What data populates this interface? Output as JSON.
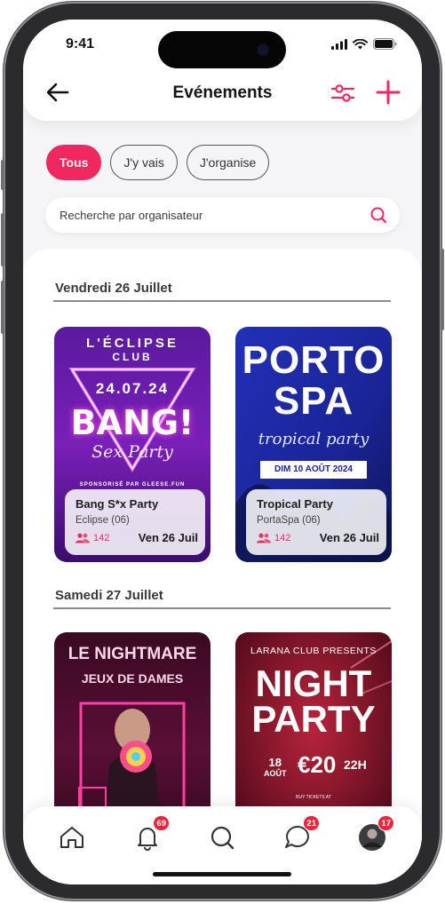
{
  "status": {
    "time": "9:41"
  },
  "header": {
    "title": "Evénements"
  },
  "filters": [
    {
      "label": "Tous",
      "active": true
    },
    {
      "label": "J'y vais",
      "active": false
    },
    {
      "label": "J'organise",
      "active": false
    }
  ],
  "search": {
    "placeholder": "Recherche par organisateur"
  },
  "sections": [
    {
      "title": "Vendredi 26 Juillet",
      "events": [
        {
          "name": "Bang S*x Party",
          "organizer": "Eclipse (06)",
          "attendees": "142",
          "date": "Ven 26 Juil",
          "poster": {
            "line1": "L'ÉCLIPSE",
            "line2": "CLUB",
            "date": "24.07.24",
            "main": "BANG!",
            "script": "Sex Party",
            "footer": "SPONSORISÉ PAR GLEESE.FUN"
          }
        },
        {
          "name": "Tropical Party",
          "organizer": "PortaSpa (06)",
          "attendees": "142",
          "date": "Ven 26 Juil",
          "poster": {
            "line1": "PORTO",
            "line2": "SPA",
            "script": "tropical party",
            "date": "DIM 10 AOÛT 2024"
          }
        }
      ]
    },
    {
      "title": "Samedi 27 Juillet",
      "events": [
        {
          "poster": {
            "line1": "LE NIGHTMARE",
            "line2": "JEUX DE DAMES"
          }
        },
        {
          "poster": {
            "line0": "LARANA CLUB PRESENTS",
            "line1": "NIGHT",
            "line2": "PARTY",
            "day": "18",
            "month": "AOÛT",
            "price": "€20",
            "hour": "22H",
            "small": "BUY TICKETS AT"
          }
        }
      ]
    }
  ],
  "nav": {
    "notifications_badge": "69",
    "messages_badge": "21",
    "profile_badge": "17"
  },
  "colors": {
    "accent": "#f0285f",
    "badge": "#e8263c"
  }
}
